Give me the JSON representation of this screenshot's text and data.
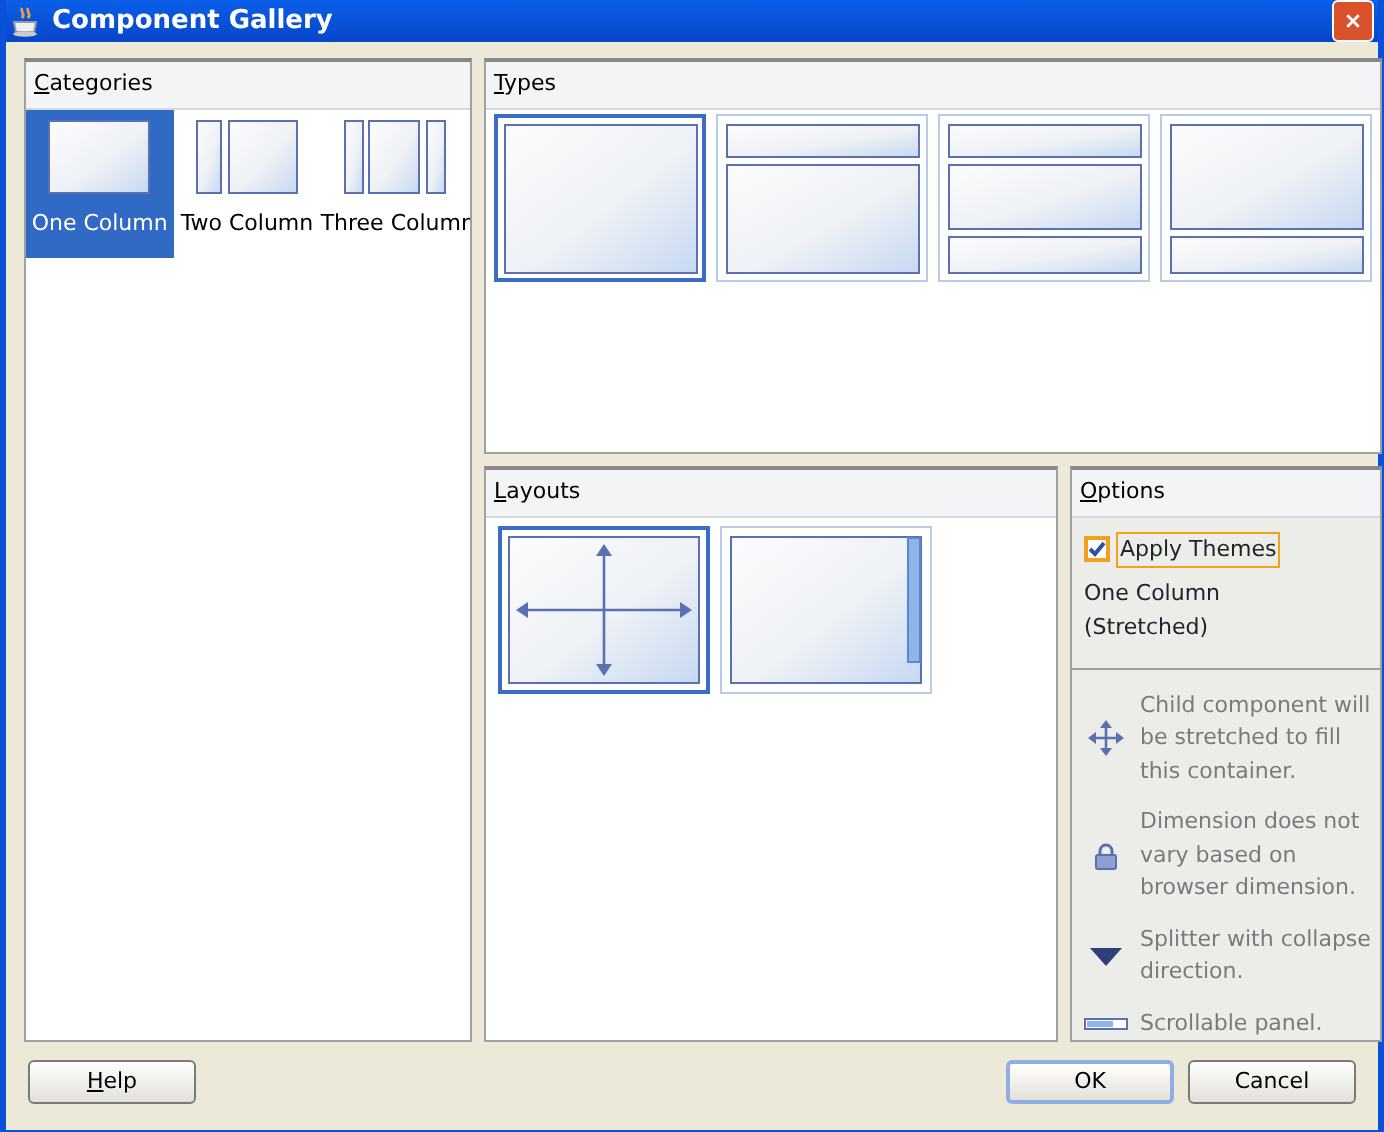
{
  "window": {
    "title": "Component Gallery"
  },
  "categories": {
    "heading": "Categories",
    "items": [
      {
        "label": "One Column",
        "kind": "one",
        "selected": true
      },
      {
        "label": "Two Column",
        "kind": "two",
        "selected": false
      },
      {
        "label": "Three Columr",
        "kind": "three",
        "selected": false
      }
    ]
  },
  "types": {
    "heading": "Types",
    "items": [
      {
        "kind": "single",
        "selected": true
      },
      {
        "kind": "header-body",
        "selected": false
      },
      {
        "kind": "header-body-footer",
        "selected": false
      },
      {
        "kind": "body-footer",
        "selected": false
      }
    ]
  },
  "layouts": {
    "heading": "Layouts",
    "items": [
      {
        "kind": "stretched",
        "selected": true
      },
      {
        "kind": "scrollable",
        "selected": false
      }
    ]
  },
  "options": {
    "heading": "Options",
    "apply_themes": {
      "label": "Apply Themes",
      "checked": true
    },
    "layout_name": "One Column (Stretched)",
    "legend": [
      {
        "kind": "stretch",
        "text": "Child component will be stretched to fill this container."
      },
      {
        "kind": "lock",
        "text": "Dimension does not vary based on browser dimension."
      },
      {
        "kind": "splitter",
        "text": "Splitter with collapse direction."
      },
      {
        "kind": "scroll",
        "text": "Scrollable panel."
      }
    ]
  },
  "buttons": {
    "help": "Help",
    "ok": "OK",
    "cancel": "Cancel"
  }
}
